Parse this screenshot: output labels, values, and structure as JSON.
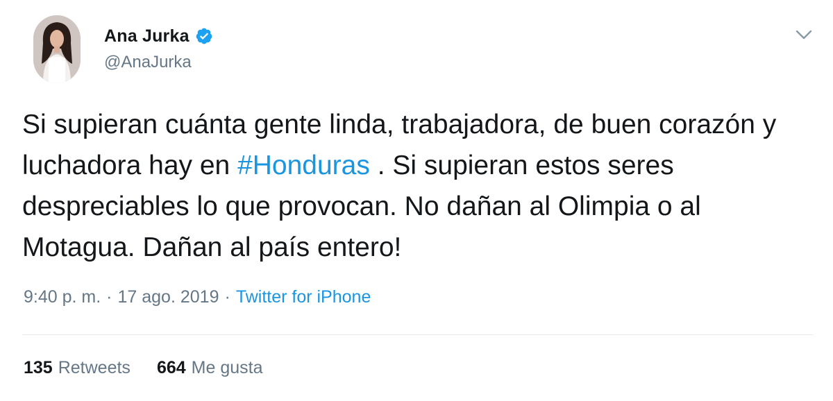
{
  "author": {
    "display_name": "Ana Jurka",
    "handle": "@AnaJurka",
    "verified": true
  },
  "tweet": {
    "text_before": "Si supieran cuánta gente linda, trabajadora, de buen corazón y luchadora hay en ",
    "hashtag": "#Honduras",
    "text_after": " . Si supieran estos seres despreciables lo que provocan. No dañan al Olimpia o al Motagua. Dañan al país entero!"
  },
  "meta": {
    "time": "9:40 p. m.",
    "separator": "·",
    "date": "17 ago. 2019",
    "source": "Twitter for iPhone"
  },
  "stats": {
    "retweets_count": "135",
    "retweets_label": "Retweets",
    "likes_count": "664",
    "likes_label": "Me gusta"
  },
  "icons": {
    "verified": "verified-badge-icon",
    "menu": "chevron-down-icon"
  },
  "colors": {
    "link": "#1b95e0",
    "muted": "#657786",
    "text": "#14171a",
    "verified": "#1da1f2"
  }
}
